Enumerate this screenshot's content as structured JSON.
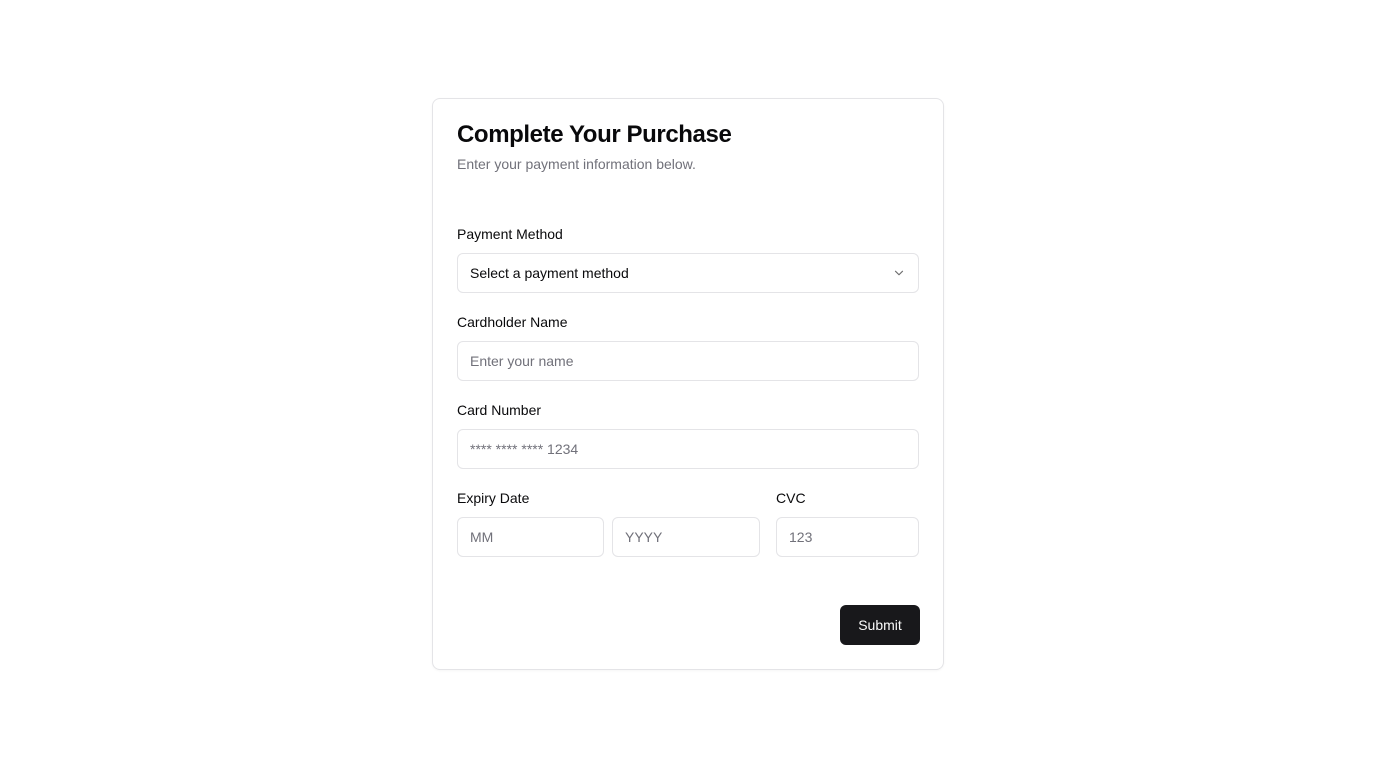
{
  "header": {
    "title": "Complete Your Purchase",
    "subtitle": "Enter your payment information below."
  },
  "payment_method": {
    "label": "Payment Method",
    "selected": "Select a payment method",
    "icon": "chevron-down-icon"
  },
  "cardholder": {
    "label": "Cardholder Name",
    "value": "",
    "placeholder": "Enter your name"
  },
  "card_number": {
    "label": "Card Number",
    "value": "",
    "placeholder": "**** **** **** 1234"
  },
  "expiry": {
    "label": "Expiry Date",
    "month_placeholder": "MM",
    "year_placeholder": "YYYY"
  },
  "cvc": {
    "label": "CVC",
    "placeholder": "123"
  },
  "submit": {
    "label": "Submit"
  },
  "colors": {
    "primary": "#18181b",
    "border": "#e4e4e7",
    "muted_text": "#71717a"
  }
}
